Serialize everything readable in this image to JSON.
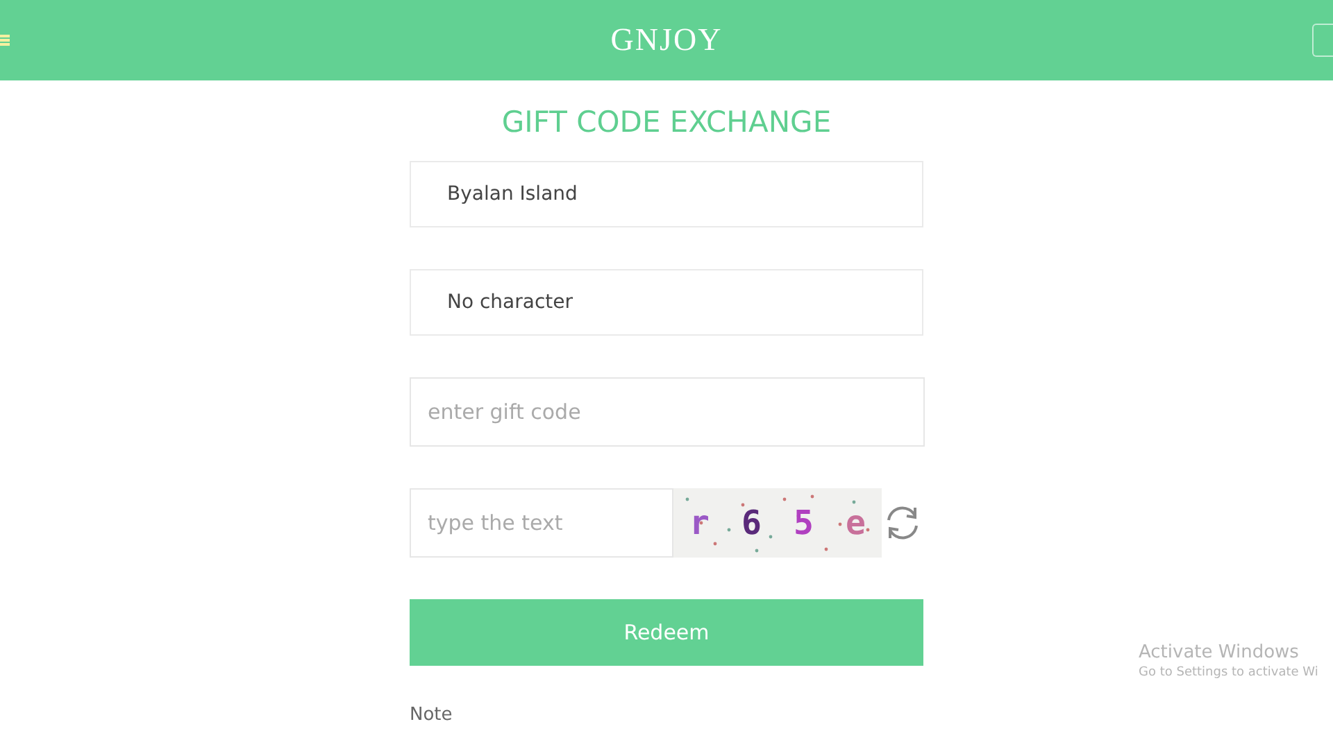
{
  "header": {
    "title": "GNJOY"
  },
  "page_title": "GIFT CODE EXCHANGE",
  "server_select": {
    "value": "Byalan Island"
  },
  "character_select": {
    "value": "No character"
  },
  "gift_code_field": {
    "placeholder": "enter gift code"
  },
  "captcha": {
    "placeholder": "type the text",
    "characters": [
      {
        "char": "r",
        "color": "#9b59c6"
      },
      {
        "char": "6",
        "color": "#5a2a7a"
      },
      {
        "char": "5",
        "color": "#b040c0"
      },
      {
        "char": "e",
        "color": "#c8709a"
      }
    ]
  },
  "redeem_button": "Redeem",
  "note_label": "Note",
  "os_overlay": {
    "title": "Activate Windows",
    "subtitle": "Go to Settings to activate Wi"
  }
}
